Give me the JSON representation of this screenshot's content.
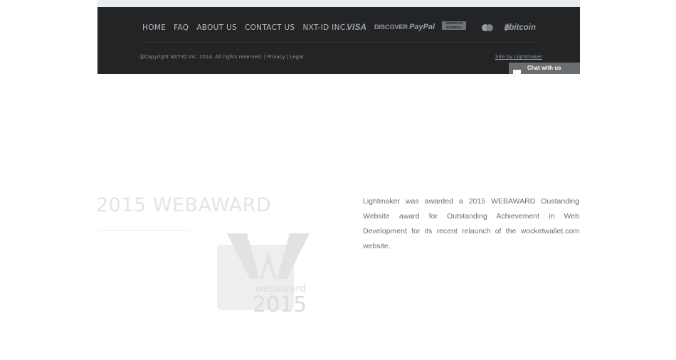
{
  "footer": {
    "nav": [
      {
        "label": "HOME"
      },
      {
        "label": "FAQ"
      },
      {
        "label": "ABOUT US"
      },
      {
        "label": "CONTACT US"
      },
      {
        "label": "NXT-ID INC."
      }
    ],
    "payments": {
      "visa": "VISA",
      "discover": "DISCOVER",
      "paypal": "PayPal",
      "amex": "AMERICAN EXPRESS",
      "mastercard_icon": "mastercard-icon",
      "bitcoin": "bitcoin"
    },
    "copyright": "@Copyright NXT-ID Inc. 2014. All rights reserved.",
    "separator": "|",
    "privacy": "Privacy",
    "legal": "Legal",
    "site_by": "Site by Lightmaker"
  },
  "chat": {
    "label": "Chat with us",
    "icon": "chat-bubble-icon"
  },
  "award": {
    "title": "2015 WEBAWARD",
    "logo_word": "webaward",
    "logo_year": "2015",
    "description": "Lightmaker was awarded a 2015 WEBAWARD Oustanding Website award for Outstanding Achievement in Web Development for its recent relaunch of the wocketwallet.com website."
  },
  "colors": {
    "footer_bg": "#232425",
    "chat_bg": "#6b6e70",
    "text_muted": "#6c6f72"
  }
}
